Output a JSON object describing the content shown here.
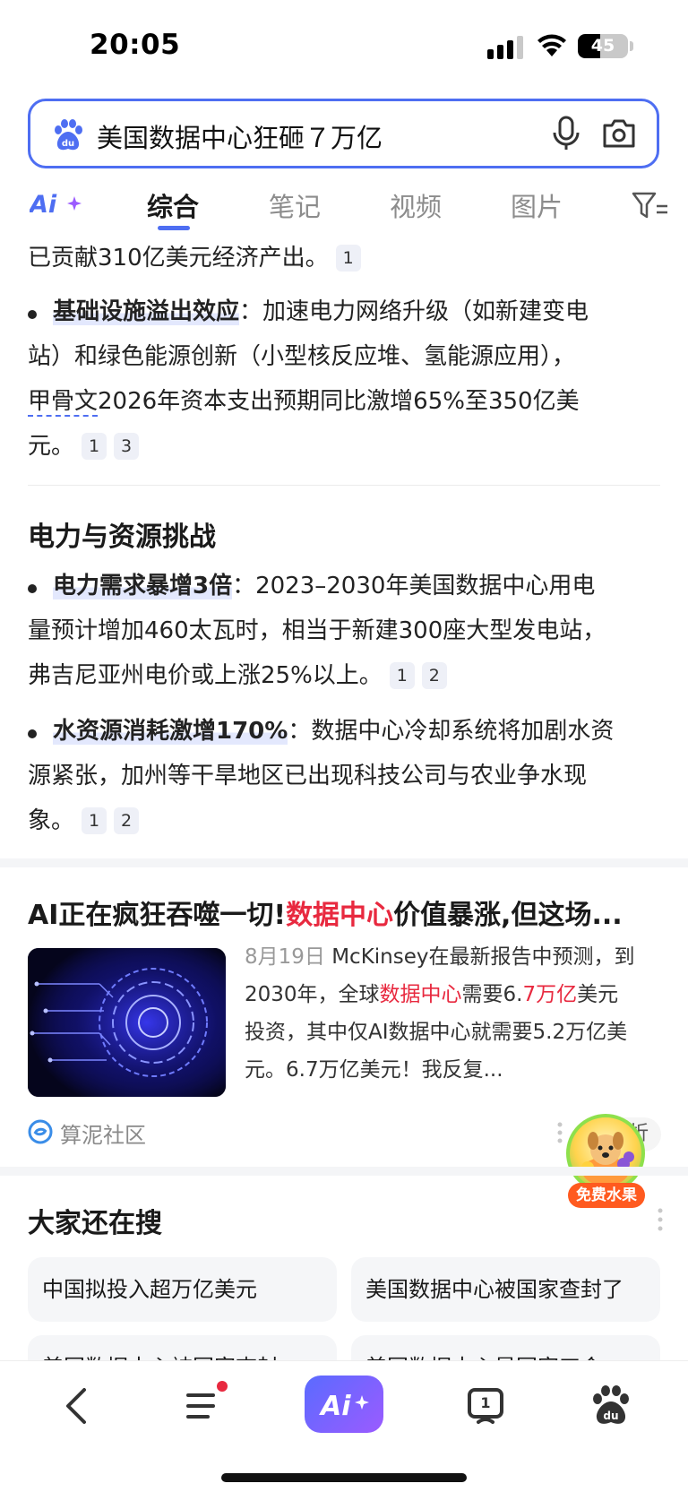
{
  "status_bar": {
    "time": "20:05",
    "battery": "45",
    "battery_level": 0.45
  },
  "search": {
    "query": "美国数据中心狂砸７万亿"
  },
  "tabs": [
    {
      "label": "综合",
      "active": true
    },
    {
      "label": "笔记",
      "active": false
    },
    {
      "label": "视频",
      "active": false
    },
    {
      "label": "图片",
      "active": false
    }
  ],
  "content": {
    "line0": {
      "text": "已贡献310亿美元经济产出。",
      "refs": [
        "1"
      ]
    },
    "bullet1": {
      "bold": "基础设施溢出效应",
      "rest1": "：加速电力网络升级（如新建变电",
      "line2": "站）和绿色能源创新（小型核反应堆、氢能源应用），",
      "line3_link": "甲骨文",
      "line3_rest": "2026年资本支出预期同比激增65%至350亿美",
      "line4": "元。",
      "refs": [
        "1",
        "3"
      ]
    },
    "section_heading": "电力与资源挑战",
    "bullet2": {
      "bold": "电力需求暴增3倍",
      "rest1": "：2023–2030年美国数据中心用电",
      "line2": "量预计增加460太瓦时，相当于新建300座大型发电站，",
      "line3": "弗吉尼亚州电价或上涨25%以上。",
      "refs": [
        "1",
        "2"
      ]
    },
    "bullet3": {
      "bold": "水资源消耗激增170%",
      "rest1": "：数据中心冷却系统将加剧水资",
      "line2": "源紧张，加州等干旱地区已出现科技公司与农业争水现",
      "line3": "象。",
      "refs": [
        "1",
        "2"
      ]
    }
  },
  "article": {
    "title_a": "AI正在疯狂吞噬一切!",
    "title_red": "数据中心",
    "title_b": "价值暴涨,但这场...",
    "date": "8月19日",
    "s1": " McKinsey在最新报告中预测，到",
    "s2_a": "2030年，全球",
    "s2_red1": "数据中心",
    "s2_b": "需要6.",
    "s2_red2": "7万亿",
    "s2_c": "美元",
    "s3": "投资，其中仅AI数据中心就需要5.2万亿美",
    "s4": "元。6.7万亿美元！我反复...",
    "source": "算泥社区",
    "feedback": "折"
  },
  "promo": {
    "label": "免费水果"
  },
  "also_searched": {
    "title": "大家还在搜",
    "items": [
      "中国拟投入超万亿美元",
      "美国数据中心被国家查封了",
      "美国数据中心被国家查封",
      "美国数据中心是国家工会"
    ]
  },
  "colors": {
    "accent": "#4e6ef2",
    "highlight_red": "#e8293f",
    "promo_orange": "#ff5a1f"
  },
  "icons": [
    "baidu-paw-icon",
    "microphone-icon",
    "camera-icon",
    "ai-plus-icon",
    "filter-icon",
    "back-arrow-icon",
    "menu-icon",
    "ai-assistant-icon",
    "reader-icon",
    "baidu-home-icon"
  ]
}
